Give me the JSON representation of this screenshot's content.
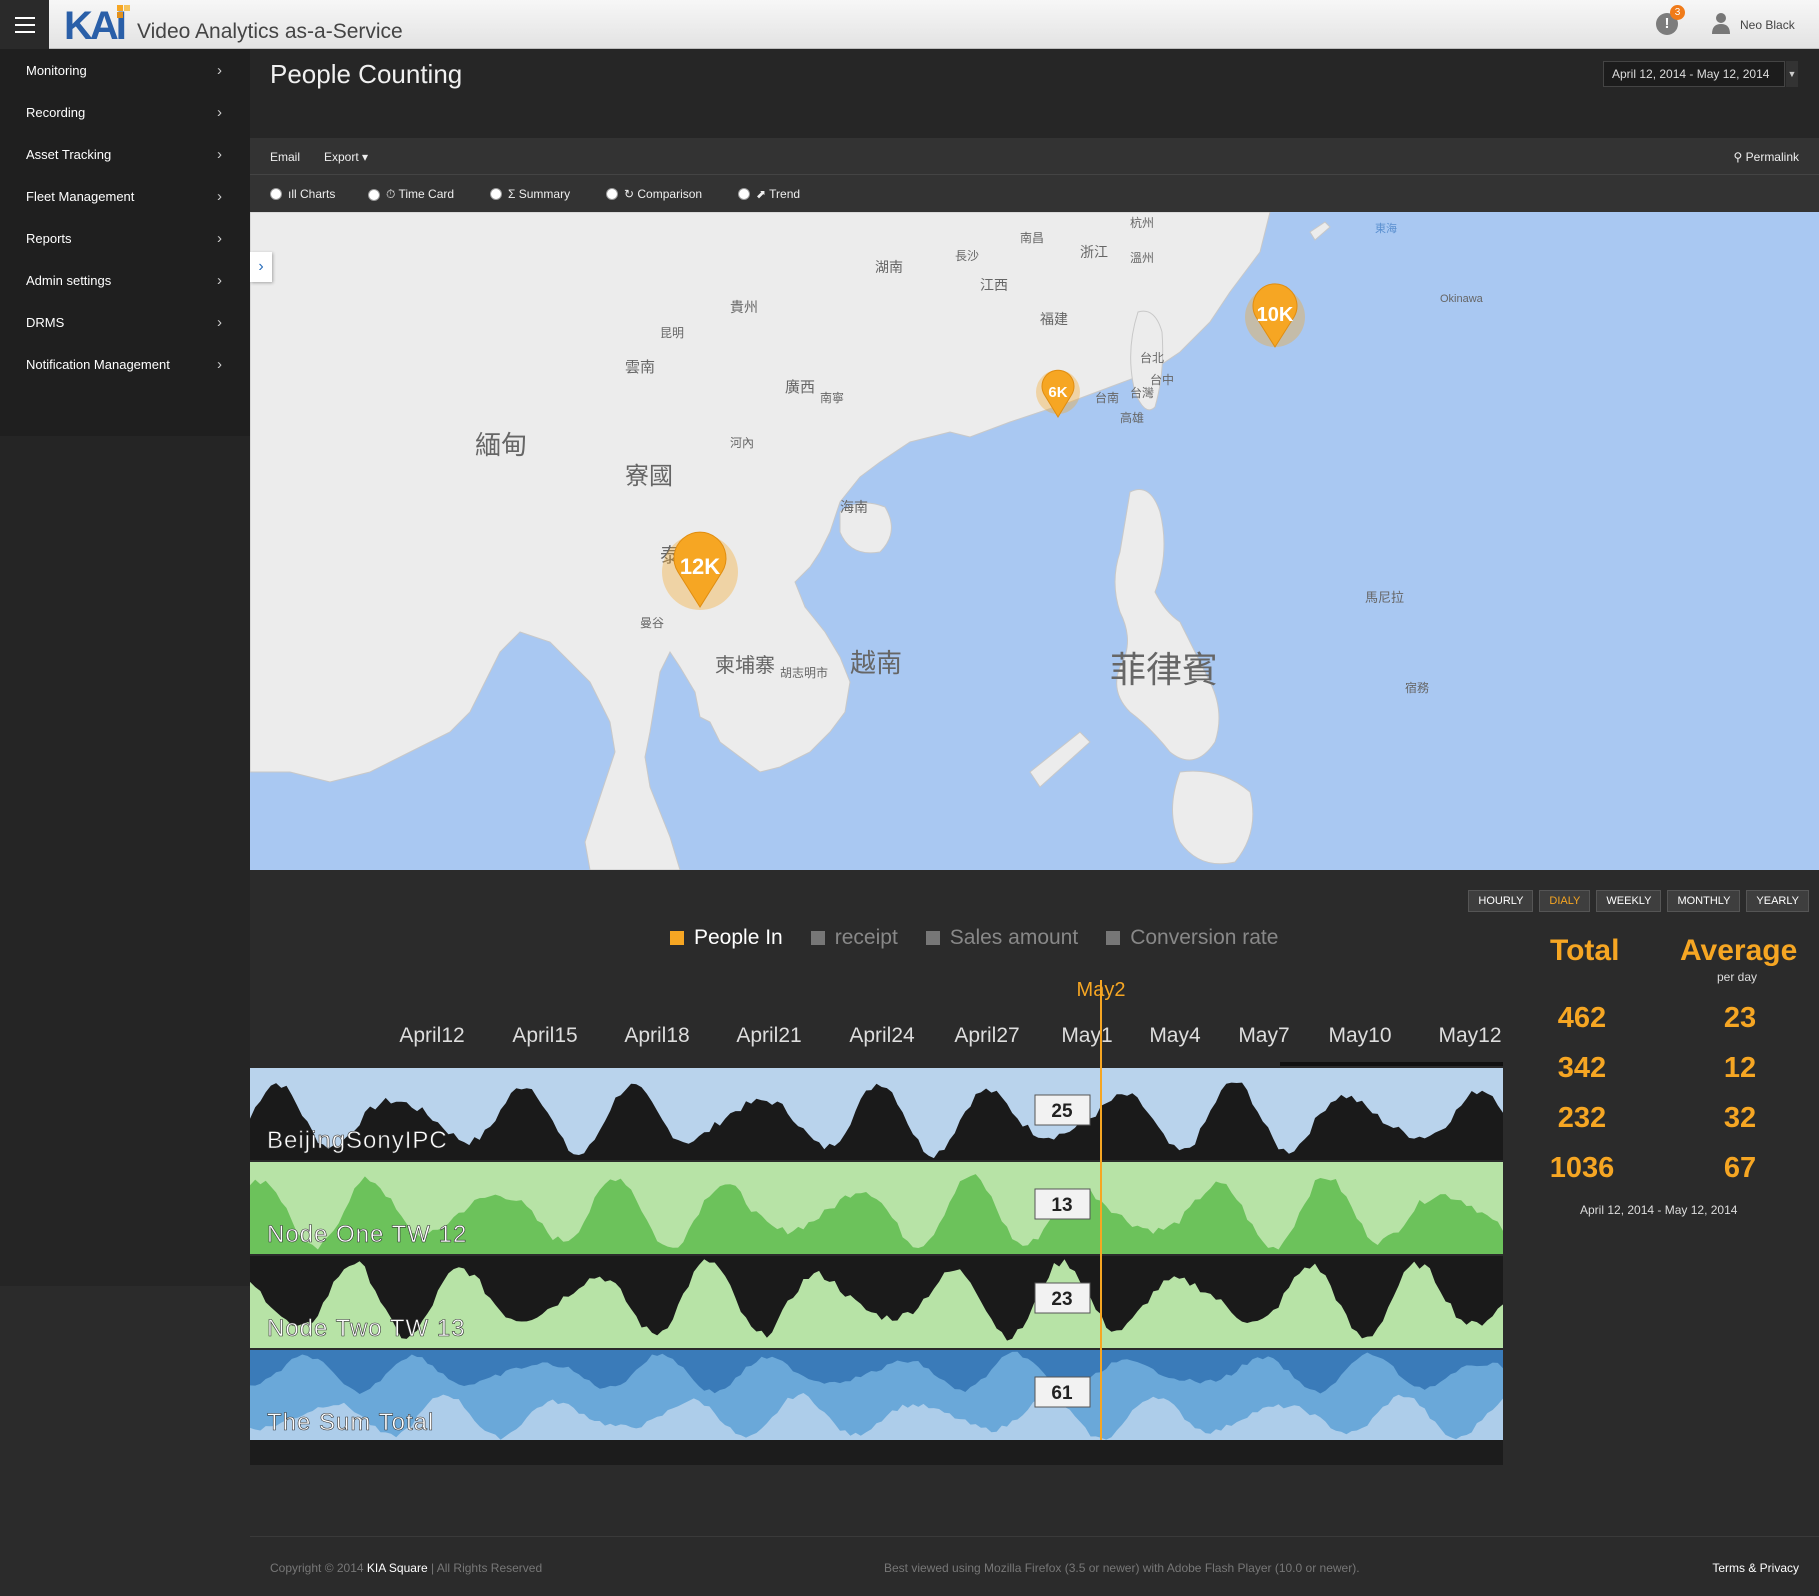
{
  "app": {
    "logo": "KAI",
    "title": "Video Analytics as-a-Service"
  },
  "header": {
    "notification_count": "3",
    "notification_glyph": "!",
    "user_name": "Neo Black"
  },
  "sidebar": {
    "items": [
      {
        "label": "Monitoring"
      },
      {
        "label": "Recording"
      },
      {
        "label": "Asset Tracking"
      },
      {
        "label": "Fleet Management"
      },
      {
        "label": "Reports"
      },
      {
        "label": "Admin settings"
      },
      {
        "label": "DRMS"
      },
      {
        "label": "Notification Management"
      }
    ]
  },
  "page": {
    "title": "People Counting",
    "date_range": "April 12, 2014 - May 12, 2014"
  },
  "toolbar": {
    "email": "Email",
    "export": "Export ▾",
    "permalink": "Permalink"
  },
  "views": [
    {
      "label": "ıll Charts"
    },
    {
      "label": "⏱ Time Card"
    },
    {
      "label": "Σ Summary"
    },
    {
      "label": "↻ Comparison"
    },
    {
      "label": "⬈ Trend"
    }
  ],
  "map": {
    "markers": [
      {
        "label": "12K"
      },
      {
        "label": "10K"
      },
      {
        "label": "6K"
      }
    ],
    "labels": [
      "緬甸",
      "寮國",
      "越南",
      "菲律賓",
      "海南",
      "雲南",
      "廣西",
      "湖南",
      "江西",
      "浙江",
      "福建",
      "貴州",
      "台灣",
      "台北",
      "台中",
      "高雄",
      "台南",
      "泰國",
      "曼谷",
      "柬埔寨",
      "河內",
      "南寧",
      "昆明",
      "長沙",
      "南昌",
      "溫州",
      "杭州",
      "馬尼拉",
      "宿務",
      "胡志明市",
      "東海",
      "Okinawa"
    ]
  },
  "periods": {
    "hourly": "HOURLY",
    "daily": "DIALY",
    "weekly": "WEEKLY",
    "monthly": "MONTHLY",
    "yearly": "YEARLY"
  },
  "legend": [
    {
      "name": "People In",
      "color": "#f6a623",
      "active": true
    },
    {
      "name": "receipt",
      "color": "#777777",
      "active": false
    },
    {
      "name": "Sales amount",
      "color": "#777777",
      "active": false
    },
    {
      "name": "Conversion rate",
      "color": "#777777",
      "active": false
    }
  ],
  "chart_data": {
    "type": "area",
    "x_ticks": [
      "April12",
      "April15",
      "April18",
      "April21",
      "April24",
      "April27",
      "May1",
      "May4",
      "May7",
      "May10",
      "May12"
    ],
    "cursor_label": "May2",
    "series": [
      {
        "name": "BeijingSonyIPC",
        "cursor_value": 25,
        "bg": "#b9d3ec",
        "fg": "#1a1a1a"
      },
      {
        "name": "Node One TW 12",
        "cursor_value": 13,
        "bg": "#b7e3a6",
        "fg": "#6cc25b"
      },
      {
        "name": "Node Two TW 13",
        "cursor_value": 23,
        "bg": "#b7e3a6",
        "fg": "#1a1a1a"
      },
      {
        "name": "The Sum Total",
        "cursor_value": 61,
        "bg": "#6aa8d9",
        "fg": "#b9d3ec"
      }
    ]
  },
  "stats": {
    "total_label": "Total",
    "average_label": "Average",
    "average_sub": "per day",
    "rows": [
      {
        "total": "462",
        "average": "23"
      },
      {
        "total": "342",
        "average": "12"
      },
      {
        "total": "232",
        "average": "32"
      },
      {
        "total": "1036",
        "average": "67"
      }
    ],
    "date_range": "April 12, 2014 - May 12, 2014"
  },
  "footer": {
    "copyright_prefix": "Copyright © 2014",
    "company": "KIA Square",
    "rights": "|  All Rights Reserved",
    "browser_note": "Best viewed using Mozilla Firefox (3.5 or newer) with Adobe Flash Player (10.0 or newer).",
    "terms": "Terms & Privacy"
  }
}
